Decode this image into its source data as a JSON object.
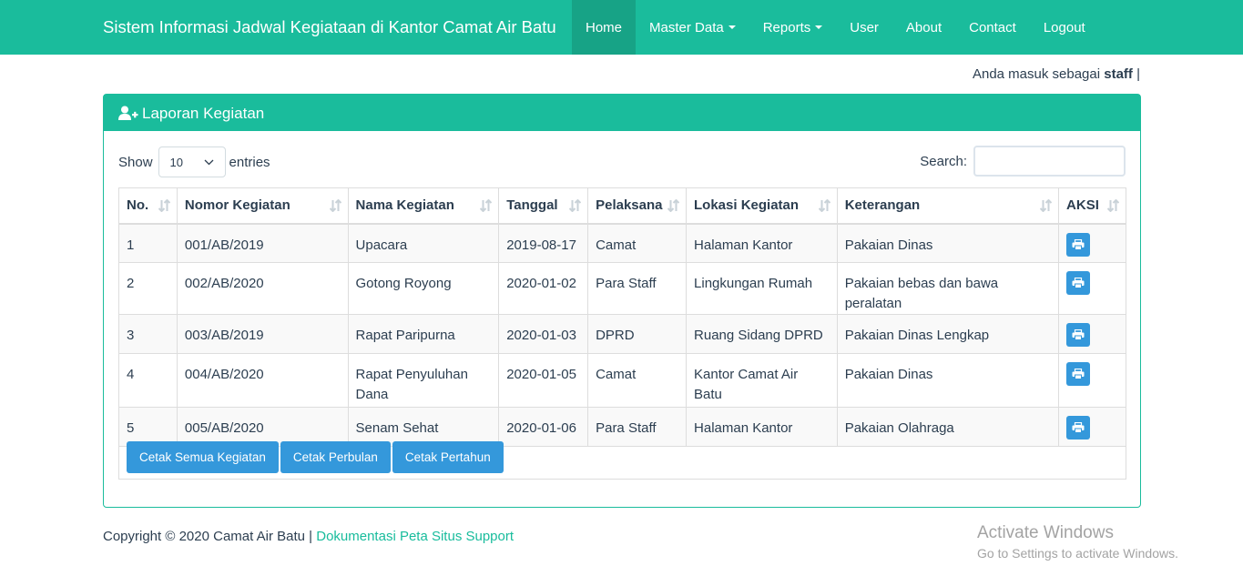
{
  "navbar": {
    "brand": "Sistem Informasi Jadwal Kegiataan di Kantor Camat Air Batu",
    "items": [
      {
        "label": "Home",
        "active": true,
        "dropdown": false
      },
      {
        "label": "Master Data",
        "active": false,
        "dropdown": true
      },
      {
        "label": "Reports",
        "active": false,
        "dropdown": true
      },
      {
        "label": "User",
        "active": false,
        "dropdown": false
      },
      {
        "label": "About",
        "active": false,
        "dropdown": false
      },
      {
        "label": "Contact",
        "active": false,
        "dropdown": false
      },
      {
        "label": "Logout",
        "active": false,
        "dropdown": false
      }
    ]
  },
  "login": {
    "prefix": "Anda masuk sebagai",
    "user": "staff",
    "suffix": "|"
  },
  "panel": {
    "title": "Laporan Kegiatan",
    "icon": "user-plus-icon"
  },
  "table_controls": {
    "show_label": "Show",
    "page_size": "10",
    "entries_label": "entries",
    "search_label": "Search:",
    "search_value": ""
  },
  "table": {
    "columns": [
      "No.",
      "Nomor Kegiatan",
      "Nama Kegiatan",
      "Tanggal",
      "Pelaksana",
      "Lokasi Kegiatan",
      "Keterangan",
      "AKSI"
    ],
    "rows": [
      {
        "no": "1",
        "nomor": "001/AB/2019",
        "nama": "Upacara",
        "tanggal": "2019-08-17",
        "pelaksana": "Camat",
        "lokasi": "Halaman Kantor",
        "keterangan": "Pakaian Dinas"
      },
      {
        "no": "2",
        "nomor": "002/AB/2020",
        "nama": "Gotong Royong",
        "tanggal": "2020-01-02",
        "pelaksana": "Para Staff",
        "lokasi": "Lingkungan Rumah",
        "keterangan": "Pakaian bebas dan bawa peralatan"
      },
      {
        "no": "3",
        "nomor": "003/AB/2019",
        "nama": "Rapat Paripurna",
        "tanggal": "2020-01-03",
        "pelaksana": "DPRD",
        "lokasi": "Ruang Sidang DPRD",
        "keterangan": "Pakaian Dinas Lengkap"
      },
      {
        "no": "4",
        "nomor": "004/AB/2020",
        "nama": "Rapat Penyuluhan Dana",
        "tanggal": "2020-01-05",
        "pelaksana": "Camat",
        "lokasi": "Kantor Camat Air Batu",
        "keterangan": "Pakaian Dinas"
      },
      {
        "no": "5",
        "nomor": "005/AB/2020",
        "nama": "Senam Sehat",
        "tanggal": "2020-01-06",
        "pelaksana": "Para Staff",
        "lokasi": "Halaman Kantor",
        "keterangan": "Pakaian Olahraga"
      }
    ]
  },
  "buttons": {
    "all": "Cetak Semua Kegiatan",
    "monthly": "Cetak Perbulan",
    "yearly": "Cetak Pertahun"
  },
  "footer": {
    "copyright": "Copyright © 2020 Camat Air Batu |",
    "links": "Dokumentasi Peta Situs Support"
  },
  "watermark": {
    "title": "Activate Windows",
    "subtitle": "Go to Settings to activate Windows."
  },
  "colors": {
    "primary": "#1abc9c",
    "active_nav": "#17a386",
    "button": "#3498db",
    "text": "#2c3e50"
  }
}
